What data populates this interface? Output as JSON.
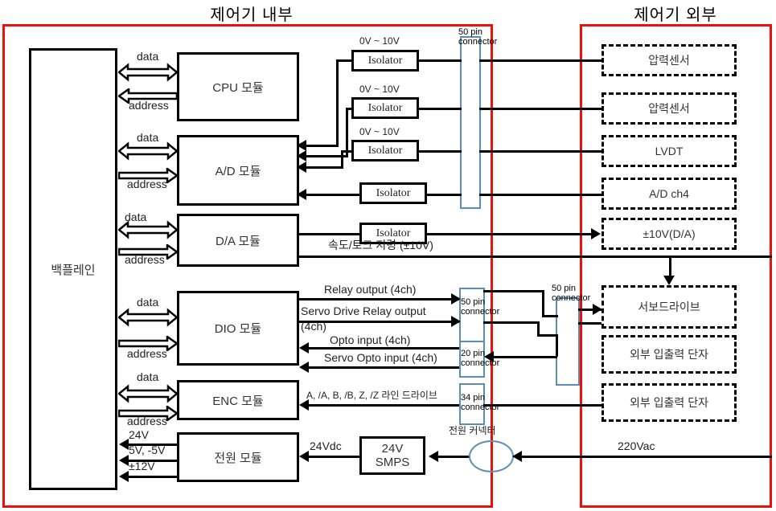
{
  "titles": {
    "internal": "제어기 내부",
    "external": "제어기 외부"
  },
  "internal_modules": {
    "backplane": "백플레인",
    "cpu": "CPU 모듈",
    "ad": "A/D 모듈",
    "da": "D/A 모듈",
    "dio": "DIO 모듈",
    "enc": "ENC 모듈",
    "power": "전원 모듈",
    "smps": "24V\nSMPS",
    "smps_line1": "24V",
    "smps_line2": "SMPS"
  },
  "bus_labels": {
    "data": "data",
    "address": "address"
  },
  "power_rails": {
    "rail_24v": "24V",
    "rail_5v": "5V, -5V",
    "rail_12v": "±12V",
    "dc_in": "24Vdc",
    "ac_in": "220Vac",
    "power_connector": "전원 커넥터"
  },
  "isolators": {
    "label": "Isolator",
    "range": "0V ~ 10V",
    "da_signal": "속도/토크 지령 (±10V)"
  },
  "connectors": {
    "c50_ad_l1": "50 pin",
    "c50_ad_l2": "connector",
    "c50_dio_l1": "50 pin",
    "c50_dio_l2": "connector",
    "c20_dio_l1": "20 pin",
    "c20_dio_l2": "connector",
    "c34_enc_l1": "34 pin",
    "c34_enc_l2": "connector",
    "c50_ext_l1": "50 pin",
    "c50_ext_l2": "connector"
  },
  "dio_signals": {
    "relay_output": "Relay output (4ch)",
    "servo_relay_output": "Servo Drive  Relay output",
    "servo_relay_output_2": "(4ch)",
    "opto_input": "Opto input (4ch)",
    "servo_opto_input": "Servo Opto input (4ch)"
  },
  "enc_signals": {
    "line_driver": "A, /A, B, /B, Z, /Z 라인 드라이브"
  },
  "external_devices": [
    {
      "label": "압력센서"
    },
    {
      "label": "압력센서"
    },
    {
      "label": "LVDT"
    },
    {
      "label": "A/D ch4"
    },
    {
      "label": "±10V(D/A)"
    },
    {
      "label": "서보드라이브"
    },
    {
      "label": "외부 입출력 단자"
    },
    {
      "label": "외부 입출력 단자"
    }
  ],
  "colors": {
    "boundary_red": "#e8120b",
    "connector_blue": "#5b8db8",
    "line_black": "#000000"
  }
}
